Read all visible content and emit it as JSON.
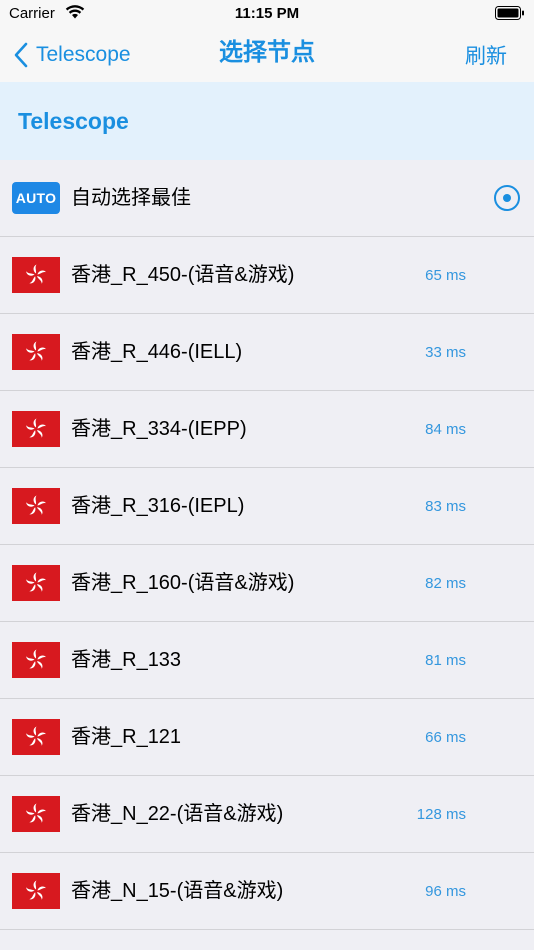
{
  "status_bar": {
    "carrier": "Carrier",
    "time": "11:15 PM"
  },
  "nav": {
    "back_label": "Telescope",
    "title": "选择节点",
    "refresh_label": "刷新"
  },
  "section": {
    "title": "Telescope"
  },
  "auto_option": {
    "badge": "AUTO",
    "label": "自动选择最佳",
    "selected": true
  },
  "nodes": [
    {
      "flag": "hong-kong-flag-icon",
      "name": "香港_R_450-(语音&游戏)",
      "latency": "65 ms"
    },
    {
      "flag": "hong-kong-flag-icon",
      "name": "香港_R_446-(IELL)",
      "latency": "33 ms"
    },
    {
      "flag": "hong-kong-flag-icon",
      "name": "香港_R_334-(IEPP)",
      "latency": "84 ms"
    },
    {
      "flag": "hong-kong-flag-icon",
      "name": "香港_R_316-(IEPL)",
      "latency": "83 ms"
    },
    {
      "flag": "hong-kong-flag-icon",
      "name": "香港_R_160-(语音&游戏)",
      "latency": "82 ms"
    },
    {
      "flag": "hong-kong-flag-icon",
      "name": "香港_R_133",
      "latency": "81 ms"
    },
    {
      "flag": "hong-kong-flag-icon",
      "name": "香港_R_121",
      "latency": "66 ms"
    },
    {
      "flag": "hong-kong-flag-icon",
      "name": "香港_N_22-(语音&游戏)",
      "latency": "128 ms"
    },
    {
      "flag": "hong-kong-flag-icon",
      "name": "香港_N_15-(语音&游戏)",
      "latency": "96 ms"
    }
  ],
  "colors": {
    "accent": "#1a8fe0",
    "section_bg": "#e3f1fc",
    "flag_red": "#d7191f",
    "latency": "#3497de"
  }
}
